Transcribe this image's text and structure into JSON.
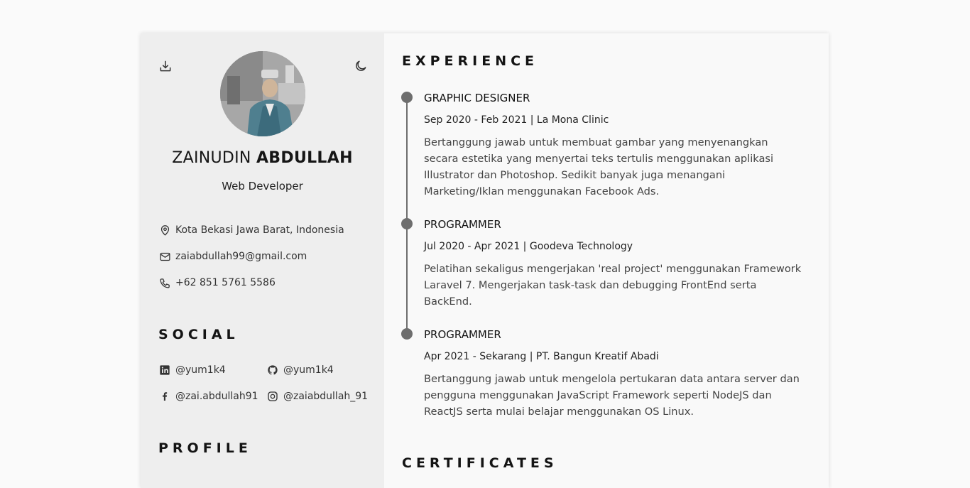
{
  "profile": {
    "first_name": "ZAINUDIN",
    "last_name": "ABDULLAH",
    "role": "Web Developer"
  },
  "contact": {
    "location": "Kota Bekasi Jawa Barat, Indonesia",
    "email": "zaiabdullah99@gmail.com",
    "phone": "+62 851 5761 5586"
  },
  "social": {
    "title": "SOCIAL",
    "linkedin": "@yum1k4",
    "github": "@yum1k4",
    "facebook": "@zai.abdullah91",
    "instagram": "@zaiabdullah_91"
  },
  "profile_section": {
    "title": "PROFILE"
  },
  "experience": {
    "title": "EXPERIENCE",
    "items": [
      {
        "title": "GRAPHIC DESIGNER",
        "meta": "Sep 2020 - Feb 2021 | La Mona Clinic",
        "description": "Bertanggung jawab untuk membuat gambar yang menyenangkan secara estetika yang menyertai teks tertulis menggunakan aplikasi Illustrator dan Photoshop. Sedikit banyak juga menangani Marketing/Iklan menggunakan Facebook Ads."
      },
      {
        "title": "PROGRAMMER",
        "meta": "Jul 2020 - Apr 2021 | Goodeva Technology",
        "description": "Pelatihan sekaligus mengerjakan 'real project' menggunakan Framework Laravel 7. Mengerjakan task-task dan debugging FrontEnd serta BackEnd."
      },
      {
        "title": "PROGRAMMER",
        "meta": "Apr 2021 - Sekarang | PT. Bangun Kreatif Abadi",
        "description": "Bertanggung jawab untuk mengelola pertukaran data antara server dan pengguna menggunakan JavaScript Framework seperti NodeJS dan ReactJS serta mulai belajar menggunakan OS Linux."
      }
    ]
  },
  "certificates": {
    "title": "CERTIFICATES"
  },
  "icons": {
    "download": "download-icon",
    "theme": "moon-icon",
    "location": "map-pin-icon",
    "email": "mail-icon",
    "phone": "phone-icon",
    "linkedin": "linkedin-icon",
    "github": "github-icon",
    "facebook": "facebook-icon",
    "instagram": "instagram-icon"
  },
  "colors": {
    "sidebar_bg": "#eeeeee",
    "content_bg": "#f9f9f9",
    "timeline": "#6e6e6e"
  }
}
